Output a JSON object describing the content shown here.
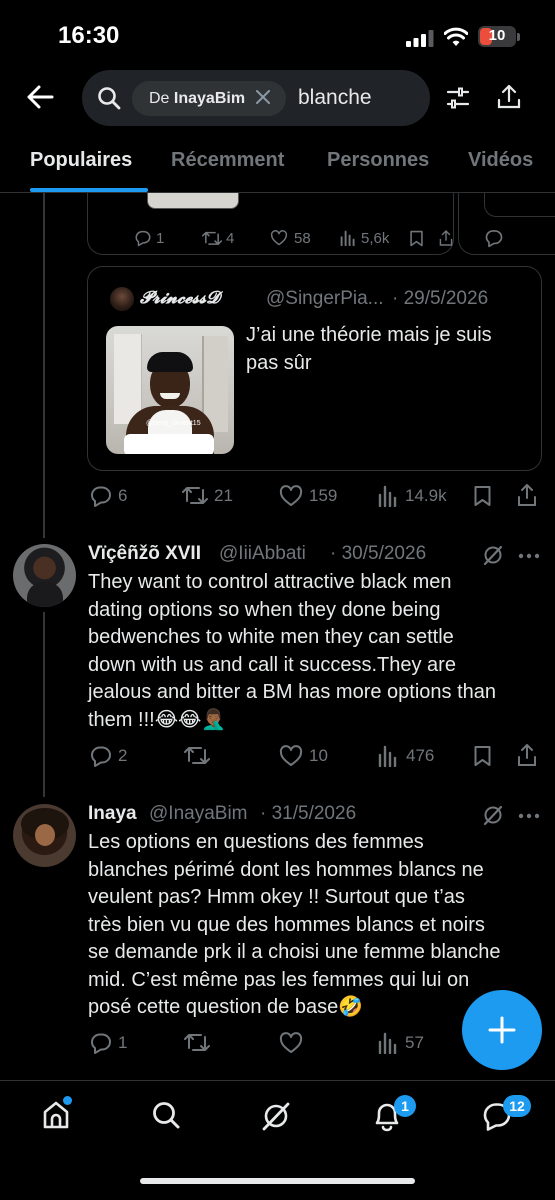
{
  "status_bar": {
    "time": "16:30",
    "battery": "10"
  },
  "search": {
    "filter_prefix": "De",
    "filter_user": "InayaBim",
    "query": "blanche"
  },
  "tabs": [
    "Populaires",
    "Récemment",
    "Personnes",
    "Vidéos"
  ],
  "prev_tweet_stats": {
    "replies": "1",
    "reposts": "4",
    "likes": "58",
    "views": "5,6k"
  },
  "quoted": {
    "name": "𝓟𝓻𝓲𝓷𝓬𝓮𝓼𝓼𝓓",
    "handle": "@SingerPia...",
    "date": "· 29/5/2026",
    "text_line1": "J’ai une théorie mais je suis",
    "text_line2": "pas sûr",
    "media_watermark": "@benji_duvent15"
  },
  "main_stats": {
    "replies": "6",
    "reposts": "21",
    "likes": "159",
    "views": "14.9k"
  },
  "reply1": {
    "name": "Vïçêñžõ XVII",
    "handle": "@IiiAbbati",
    "date": "· 30/5/2026",
    "lines": [
      "They want to control attractive black men",
      "dating options so when they done being",
      "bedwenches to white men they can settle",
      "down with us and call it success.They are",
      "jealous and bitter a BM has more options than",
      "them !!!😂😂🤦🏾‍♂️"
    ],
    "stats": {
      "replies": "2",
      "reposts": "",
      "likes": "10",
      "views": "476"
    }
  },
  "reply2": {
    "name": "Inaya",
    "handle": "@InayaBim",
    "date": "· 31/5/2026",
    "lines": [
      "Les options en questions des femmes",
      "blanches périmé dont les hommes blancs ne",
      "veulent pas? Hmm okey !! Surtout que t’as",
      "très bien vu que des hommes blancs et noirs",
      "se demande prk il a choisi une femme blanche",
      "mid. C’est même pas les femmes qui lui on",
      "posé cette question de base🤣"
    ],
    "stats": {
      "replies": "1",
      "reposts": "",
      "likes": "",
      "views": "57"
    }
  },
  "bottom_nav": {
    "notifications_badge": "1",
    "messages_badge": "12"
  },
  "colors": {
    "accent": "#1d9bf0",
    "background": "#000000",
    "muted": "#71767b",
    "text": "#e7e9ea"
  }
}
